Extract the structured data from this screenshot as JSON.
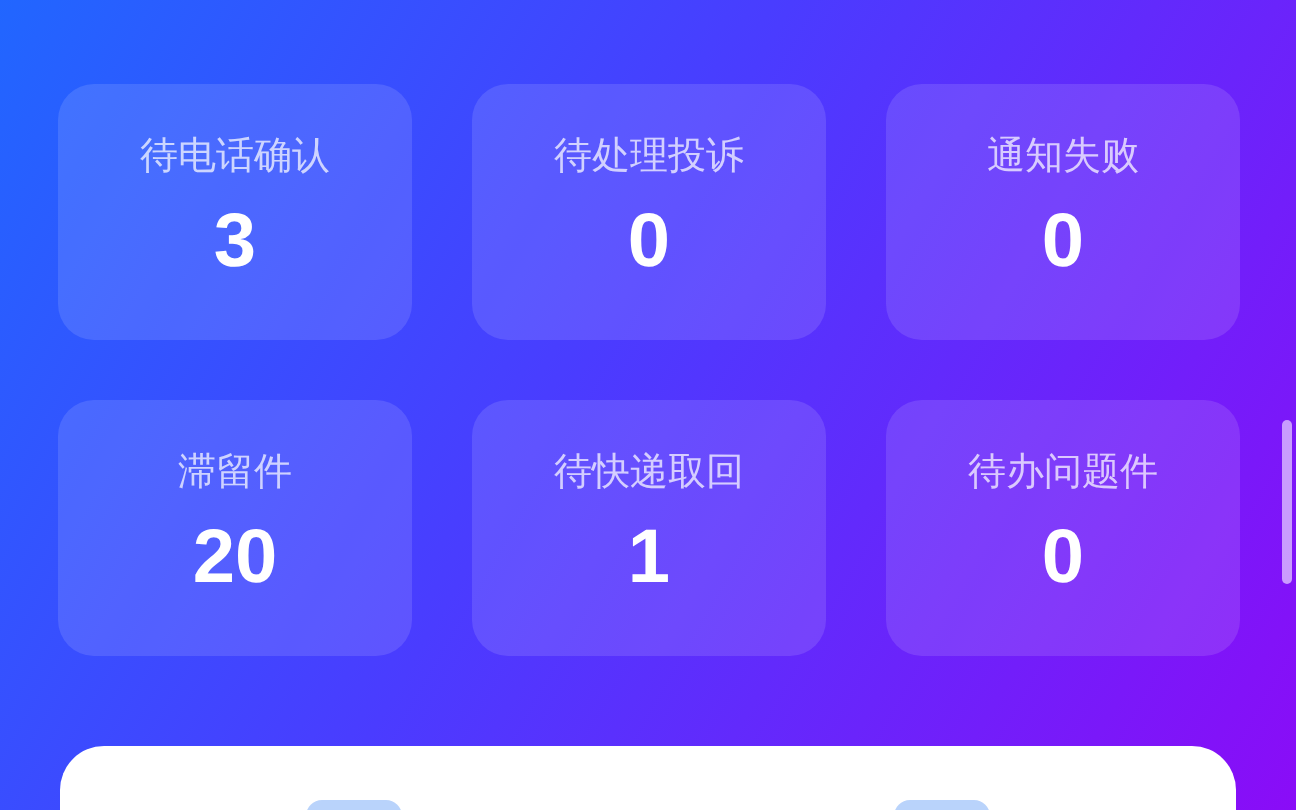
{
  "stats": [
    {
      "label": "待电话确认",
      "value": "3"
    },
    {
      "label": "待处理投诉",
      "value": "0"
    },
    {
      "label": "通知失败",
      "value": "0"
    },
    {
      "label": "滞留件",
      "value": "20"
    },
    {
      "label": "待快递取回",
      "value": "1"
    },
    {
      "label": "待办问题件",
      "value": "0"
    }
  ]
}
